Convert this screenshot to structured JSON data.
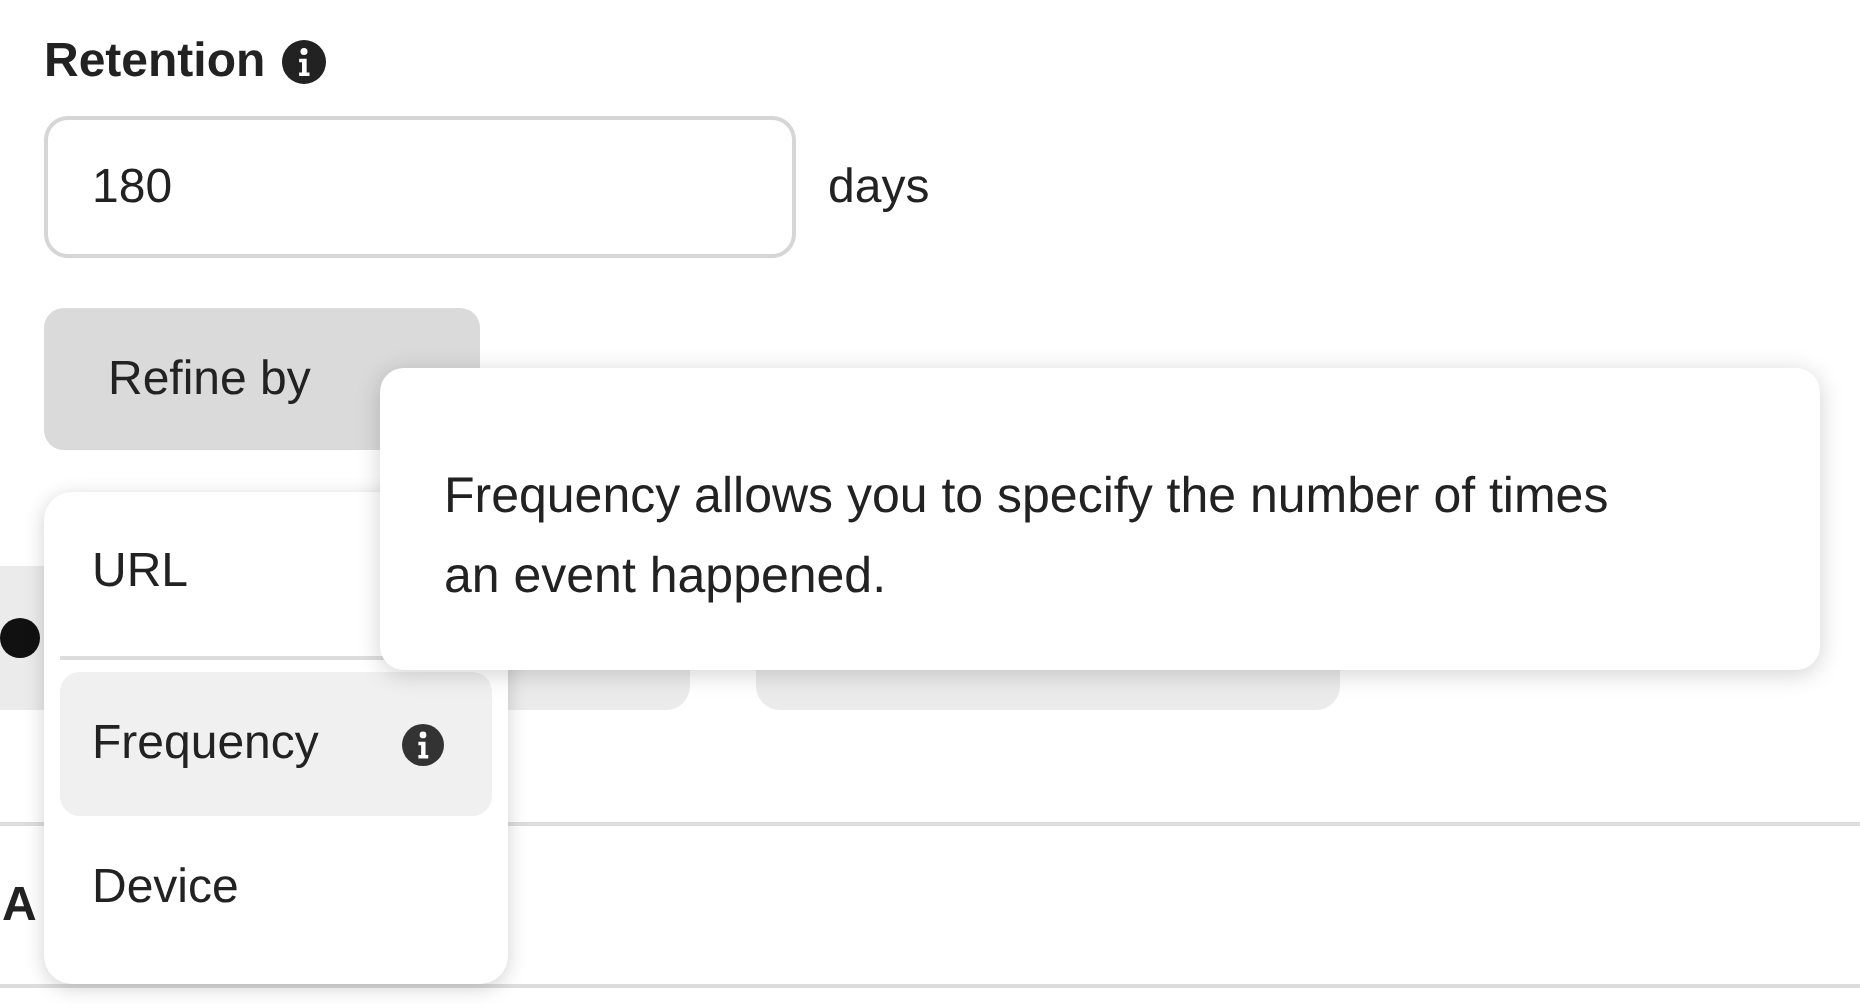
{
  "retention": {
    "label": "Retention",
    "value": "180",
    "unit": "days"
  },
  "refine_button": {
    "label": "Refine by"
  },
  "section_heading": "A",
  "menu": {
    "items": [
      {
        "label": "URL",
        "highlighted": false
      },
      {
        "label": "Frequency",
        "highlighted": true,
        "info": true
      },
      {
        "label": "Device",
        "highlighted": false
      }
    ]
  },
  "tooltip": {
    "text": "Frequency allows you to specify the number of times an event happened."
  }
}
